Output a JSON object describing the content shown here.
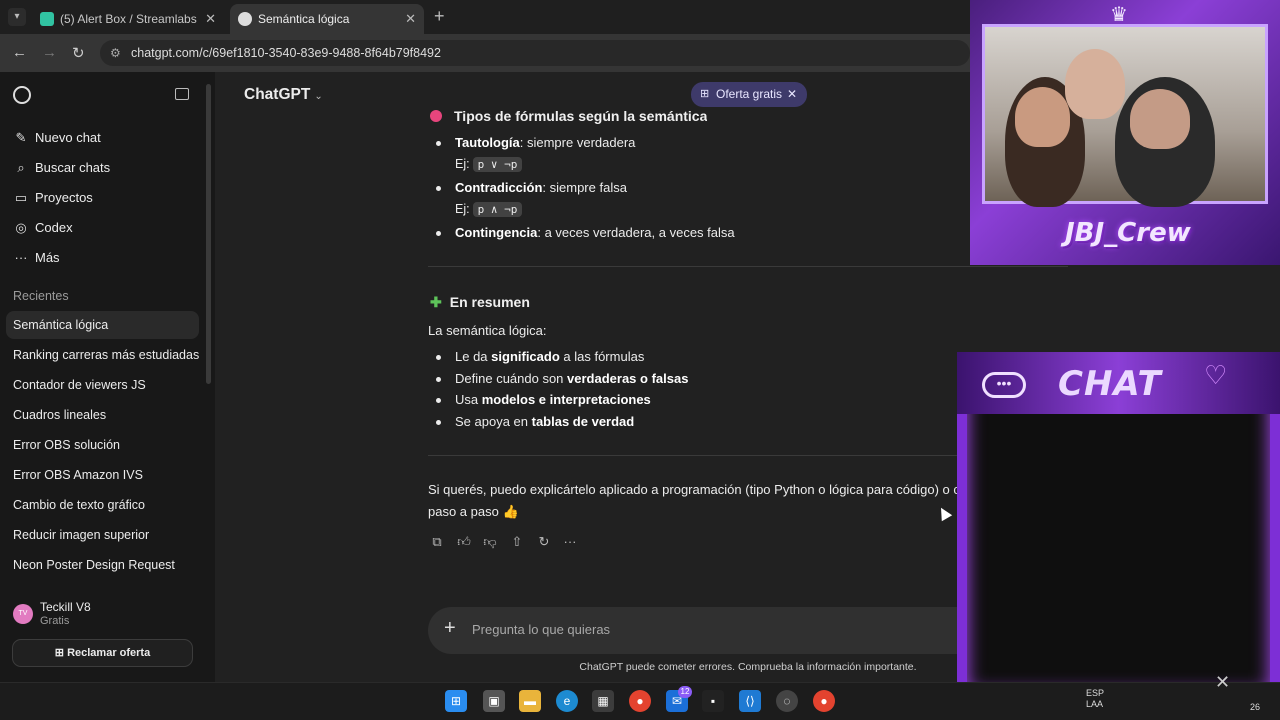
{
  "browser": {
    "tabs": [
      {
        "title": "(5) Alert Box / Streamlabs",
        "active": false
      },
      {
        "title": "Semántica lógica",
        "active": true
      }
    ],
    "url": "chatgpt.com/c/69ef1810-3540-83e9-9488-8f64b79f8492"
  },
  "sidebar": {
    "menu": [
      {
        "label": "Nuevo chat",
        "icon": "edit-icon"
      },
      {
        "label": "Buscar chats",
        "icon": "search-icon"
      },
      {
        "label": "Proyectos",
        "icon": "folder-icon"
      },
      {
        "label": "Codex",
        "icon": "codex-icon"
      },
      {
        "label": "Más",
        "icon": "more-icon"
      }
    ],
    "recents_label": "Recientes",
    "recents": [
      "Semántica lógica",
      "Ranking carreras más estudiadas",
      "Contador de viewers JS",
      "Cuadros lineales",
      "Error OBS solución",
      "Error OBS Amazon IVS",
      "Cambio de texto gráfico",
      "Reducir imagen superior",
      "Neon Poster Design Request"
    ],
    "user": {
      "initials": "TV",
      "name": "Teckill V8",
      "plan": "Gratis"
    },
    "claim_button": "Reclamar oferta"
  },
  "header": {
    "model": "ChatGPT",
    "offer": "Oferta gratis"
  },
  "content": {
    "section1_title": "Tipos de fórmulas según la semántica",
    "formula_types": [
      {
        "term": "Tautología",
        "desc": ": siempre verdadera",
        "example_label": "Ej:",
        "example": "p ∨ ¬p"
      },
      {
        "term": "Contradicción",
        "desc": ": siempre falsa",
        "example_label": "Ej:",
        "example": "p ∧ ¬p"
      },
      {
        "term": "Contingencia",
        "desc": ": a veces verdadera, a veces falsa"
      }
    ],
    "summary_title": "En resumen",
    "summary_intro": "La semántica lógica:",
    "summary_items": [
      {
        "pre": "Le da ",
        "bold": "significado",
        "post": " a las fórmulas"
      },
      {
        "pre": "Define cuándo son ",
        "bold": "verdaderas o falsas",
        "post": ""
      },
      {
        "pre": "Usa ",
        "bold": "modelos e interpretaciones",
        "post": ""
      },
      {
        "pre": "Se apoya en ",
        "bold": "tablas de verdad",
        "post": ""
      }
    ],
    "closing_line1": "Si querés, puedo explicártelo aplicado a programación (tipo Python o lógica para código) o con ejercicios",
    "closing_line2": "paso a paso 👍"
  },
  "composer": {
    "placeholder": "Pregunta lo que quieras",
    "disclaimer": "ChatGPT puede cometer errores. Comprueba la información importante."
  },
  "overlay": {
    "crew_name": "JBJ_Crew",
    "chat_title": "CHAT"
  },
  "taskbar": {
    "badge_count": "12",
    "tray_line1": "ESP",
    "tray_line2": "LAA",
    "tray_right": "26"
  }
}
